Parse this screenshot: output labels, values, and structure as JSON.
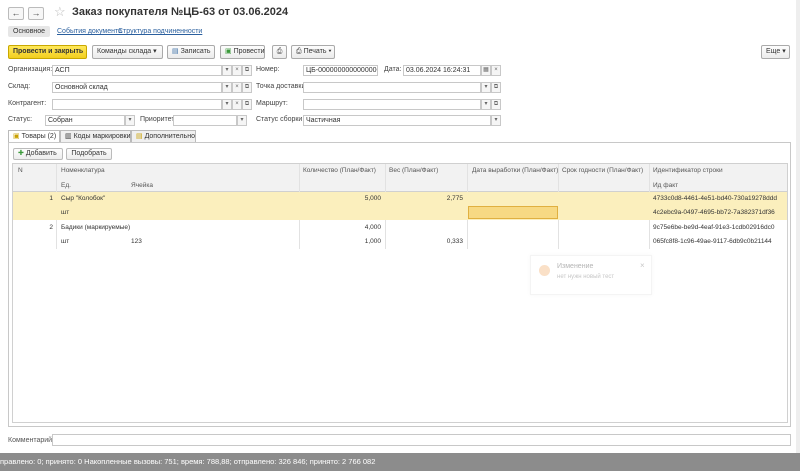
{
  "window": {
    "back_icon": "←",
    "forward_icon": "→",
    "star_icon": "☆",
    "title": "Заказ покупателя №ЦБ-63 от 03.06.2024"
  },
  "tabs_top": [
    {
      "label": "Основное"
    },
    {
      "label": "События документа"
    },
    {
      "label": "Структура подчиненности"
    }
  ],
  "toolbar": {
    "post_close": "Провести и закрыть",
    "warehouse_cmds": "Команды склада",
    "save": "Записать",
    "post": "Провести",
    "print": "Печать",
    "more": "Еще"
  },
  "form": {
    "org_label": "Организация:",
    "org_value": "АСП",
    "number_label": "Номер:",
    "number_value": "ЦБ-00000000000000063",
    "date_label": "Дата:",
    "date_value": "03.06.2024 16:24:31",
    "warehouse_label": "Склад:",
    "warehouse_value": "Основной склад",
    "delivery_label": "Точка доставки:",
    "delivery_value": "",
    "counterparty_label": "Контрагент:",
    "counterparty_value": "",
    "route_label": "Маршрут:",
    "route_value": "",
    "status_label": "Статус:",
    "status_value": "Собран",
    "priority_label": "Приоритет:",
    "priority_value": "",
    "assembly_label": "Статус сборки:",
    "assembly_value": "Частичная"
  },
  "inner_tabs": [
    {
      "label": "Товары (2)"
    },
    {
      "label": "Коды маркировки"
    },
    {
      "label": "Дополнительно"
    }
  ],
  "table_toolbar": {
    "add": "Добавить",
    "pick": "Подобрать"
  },
  "table": {
    "headers": {
      "n": "N",
      "nomenclature": "Номенклатура",
      "unit": "Ед.",
      "cell": "Ячейка",
      "qty": "Количество (План/Факт)",
      "weight": "Вес (План/Факт)",
      "prod_date": "Дата выработки (План/Факт)",
      "expiry": "Срок годности (План/Факт)",
      "row_id": "Идентификатор строки",
      "fact_id": "Ид факт"
    },
    "rows": [
      {
        "n": "1",
        "name": "Сыр \"Колобок\"",
        "qty": "5,000",
        "weight": "2,775",
        "row_id": "4733c0d8-4461-4e51-bd40-730a19278ddd",
        "unit": "шт",
        "cell": "",
        "qty2": "",
        "weight2": "",
        "fact_id": "4c2ebc9a-0497-4695-bb72-7a382371df36"
      },
      {
        "n": "2",
        "name": "Бадики (маркируемые)",
        "qty": "4,000",
        "weight": "",
        "row_id": "9c75e6be-be9d-4eaf-91e3-1cdb02916dc0",
        "unit": "шт",
        "cell": "123",
        "qty2": "1,000",
        "weight2": "0,333",
        "fact_id": "065fc8f8-1c96-49ae-9117-6db9c0b21144"
      }
    ]
  },
  "notification": {
    "title": "Изменение",
    "text": "нет нужн новый тест",
    "close": "×"
  },
  "footer": {
    "comment_label": "Комментарий:",
    "comment_value": ""
  },
  "status_bar": "правлено: 0; принято: 0    Накопленные вызовы: 751; время: 788,88; отправлено: 326 846; принято: 2 766 082"
}
